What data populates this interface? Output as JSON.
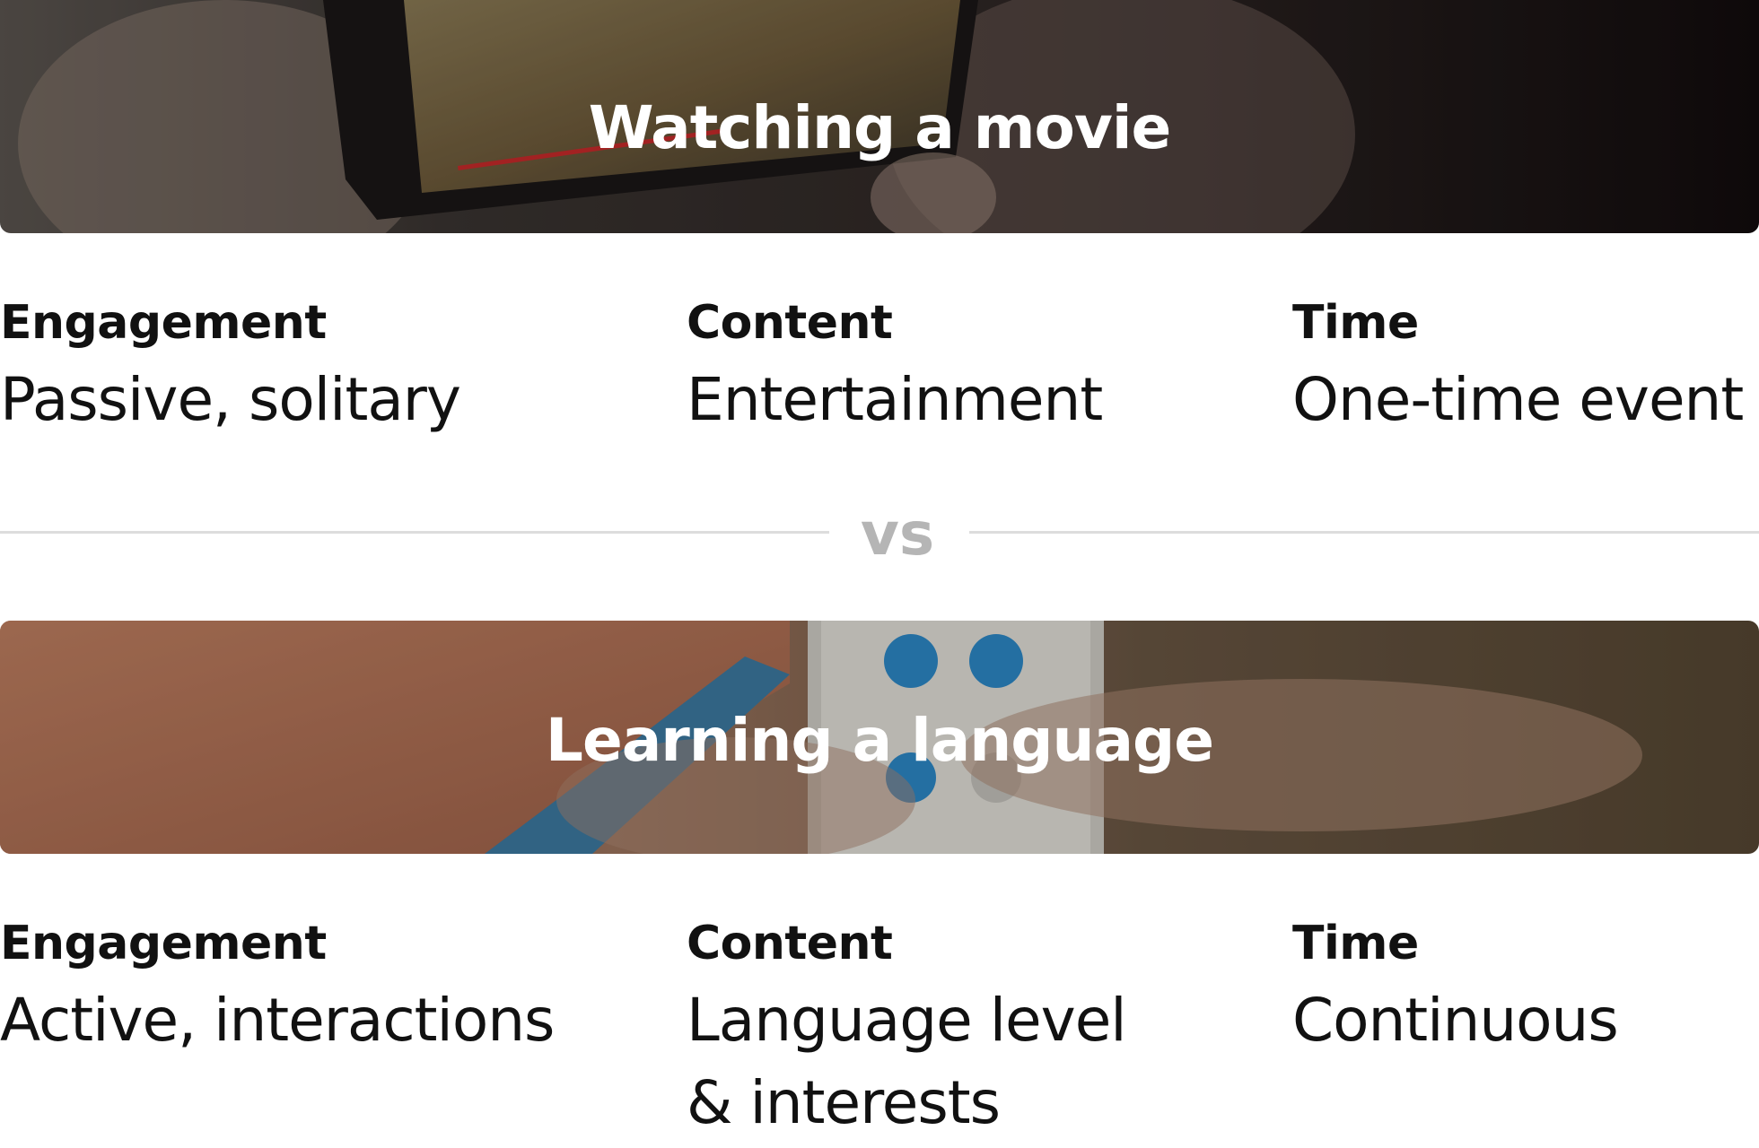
{
  "movie": {
    "title": "Watching a movie",
    "attributes": [
      {
        "label": "Engagement",
        "value": "Passive, solitary"
      },
      {
        "label": "Content",
        "value": "Entertainment"
      },
      {
        "label": "Time",
        "value": "One-time event"
      }
    ]
  },
  "separator": {
    "label": "vs"
  },
  "language": {
    "title": "Learning a language",
    "attributes": [
      {
        "label": "Engagement",
        "value": "Active, interactions"
      },
      {
        "label": "Content",
        "value": "Language level\n& interests"
      },
      {
        "label": "Time",
        "value": "Continuous"
      }
    ]
  },
  "colors": {
    "text": "#111111",
    "vs": "#b5b5b5",
    "divider": "#dddddd"
  }
}
